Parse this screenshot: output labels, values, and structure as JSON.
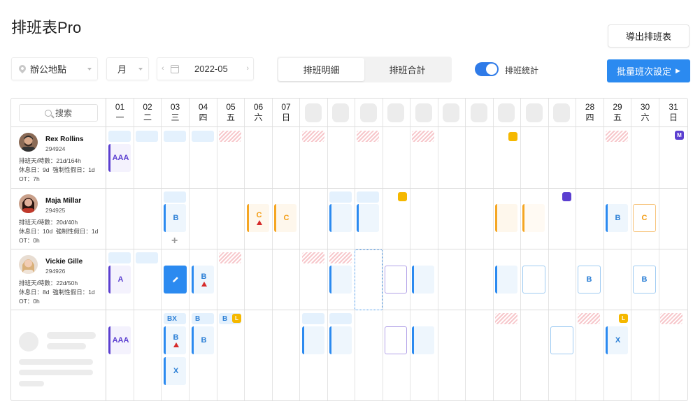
{
  "page": {
    "title": "排班表Pro",
    "export_label": "導出排班表",
    "location": "辦公地點",
    "mode": "月",
    "month": "2022-05",
    "tab_detail": "排班明細",
    "tab_total": "排班合計",
    "toggle_label": "排班統計",
    "batch_label": "批量班次設定"
  },
  "search": {
    "label": "搜索"
  },
  "days": [
    {
      "d": "01",
      "w": "一"
    },
    {
      "d": "02",
      "w": "二"
    },
    {
      "d": "03",
      "w": "三"
    },
    {
      "d": "04",
      "w": "四"
    },
    {
      "d": "05",
      "w": "五"
    },
    {
      "d": "06",
      "w": "六"
    },
    {
      "d": "07",
      "w": "日"
    },
    {
      "d": "28",
      "w": "四"
    },
    {
      "d": "29",
      "w": "五"
    },
    {
      "d": "30",
      "w": "六"
    },
    {
      "d": "31",
      "w": "日"
    }
  ],
  "employees": [
    {
      "name": "Rex Rollins",
      "id": "294924",
      "shift_days": "排班天/時數：21d/164h",
      "rest": "休息日：9d",
      "forced": "強制性假日：1d",
      "ot": "OT：7h"
    },
    {
      "name": "Maja Millar",
      "id": "294925",
      "shift_days": "排班天/時數：20d/40h",
      "rest": "休息日：10d",
      "forced": "強制性假日：1d",
      "ot": "OT：0h"
    },
    {
      "name": "Vickie Gille",
      "id": "294926",
      "shift_days": "排班天/時數：22d/50h",
      "rest": "休息日：8d",
      "forced": "強制性假日：1d",
      "ot": "OT：0h"
    }
  ],
  "shifts": {
    "aaa": "AAA",
    "a": "A",
    "b": "B",
    "c": "C",
    "x": "X",
    "bx": "BX",
    "l": "L",
    "m": "M"
  },
  "colors": {
    "accent": "#2b8af0",
    "purple": "#5b3fd0",
    "orange": "#f5a623",
    "amber": "#f5b800",
    "warning": "#d62b2b"
  }
}
